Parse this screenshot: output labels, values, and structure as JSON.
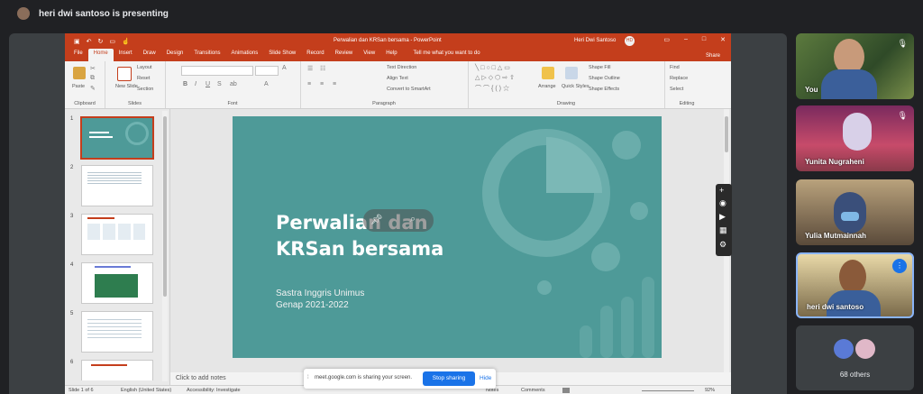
{
  "meet": {
    "presenting_label": "heri dwi santoso is presenting",
    "others_label": "68 others",
    "share_toast": {
      "message": "meet.google.com is sharing your screen.",
      "stop_label": "Stop sharing",
      "hide_label": "Hide"
    },
    "participants": [
      {
        "name": "You"
      },
      {
        "name": "Yunita Nugraheni"
      },
      {
        "name": "Yulia Mutmainnah"
      },
      {
        "name": "heri dwi santoso"
      }
    ]
  },
  "ppt": {
    "window_title": "Perwalian dan KRSan bersama - PowerPoint",
    "user_name": "Heri Dwi Santoso",
    "user_initials": "HD",
    "tabs": [
      "File",
      "Home",
      "Insert",
      "Draw",
      "Design",
      "Transitions",
      "Animations",
      "Slide Show",
      "Record",
      "Review",
      "View",
      "Help"
    ],
    "tell_me": "Tell me what you want to do",
    "share_label": "Share",
    "ribbon": {
      "clipboard": {
        "label": "Clipboard",
        "paste": "Paste"
      },
      "slides": {
        "label": "Slides",
        "new_slide": "New Slide",
        "layout": "Layout",
        "reset": "Reset",
        "section": "Section"
      },
      "font": {
        "label": "Font"
      },
      "paragraph": {
        "label": "Paragraph",
        "text_direction": "Text Direction",
        "align_text": "Align Text",
        "convert": "Convert to SmartArt"
      },
      "drawing": {
        "label": "Drawing",
        "arrange": "Arrange",
        "quick_styles": "Quick Styles",
        "shape_fill": "Shape Fill",
        "shape_outline": "Shape Outline",
        "shape_effects": "Shape Effects"
      },
      "editing": {
        "label": "Editing",
        "find": "Find",
        "replace": "Replace",
        "select": "Select"
      }
    },
    "slide_numbers": [
      "1",
      "2",
      "3",
      "4",
      "5",
      "6"
    ],
    "slide": {
      "title_line1": "Perwalian dan",
      "title_line2": "KRSan bersama",
      "sub_line1": "Sastra Inggris Unimus",
      "sub_line2": "Genap 2021-2022"
    },
    "notes_placeholder": "Click to add notes",
    "status": {
      "slide_of": "Slide 1 of 6",
      "language": "English (United States)",
      "accessibility": "Accessibility: Investigate",
      "notes": "Notes",
      "comments": "Comments",
      "zoom": "92%"
    }
  },
  "colors": {
    "ppt_accent": "#c43e1c",
    "slide_bg": "#4e9a98",
    "meet_bg": "#202124",
    "stop_button": "#1a73e8"
  }
}
